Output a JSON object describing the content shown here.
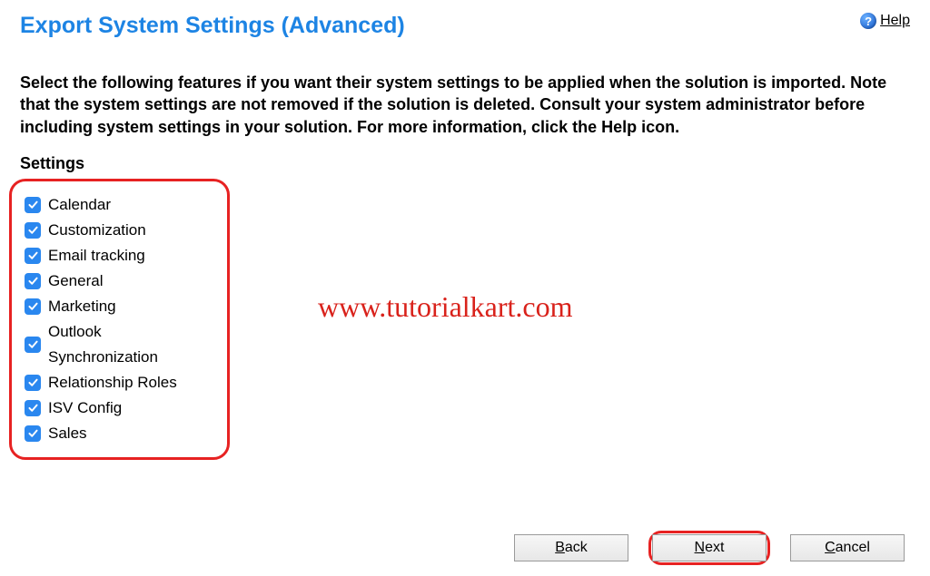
{
  "header": {
    "title": "Export System Settings (Advanced)",
    "help_label": "Help",
    "help_glyph": "?"
  },
  "description": "Select the following features if you want their system settings to be applied when the solution is imported. Note that the system settings are not removed if the solution is deleted. Consult your system administrator before including system settings in your solution. For more information, click the Help icon.",
  "settings_heading": "Settings",
  "settings": [
    {
      "label": "Calendar",
      "checked": true
    },
    {
      "label": "Customization",
      "checked": true
    },
    {
      "label": "Email tracking",
      "checked": true
    },
    {
      "label": "General",
      "checked": true
    },
    {
      "label": "Marketing",
      "checked": true
    },
    {
      "label": "Outlook Synchronization",
      "checked": true
    },
    {
      "label": "Relationship Roles",
      "checked": true
    },
    {
      "label": "ISV Config",
      "checked": true
    },
    {
      "label": "Sales",
      "checked": true
    }
  ],
  "watermark": "www.tutorialkart.com",
  "buttons": {
    "back": {
      "prefix": "B",
      "rest": "ack"
    },
    "next": {
      "prefix": "N",
      "rest": "ext"
    },
    "cancel": {
      "prefix": "C",
      "rest": "ancel"
    }
  }
}
